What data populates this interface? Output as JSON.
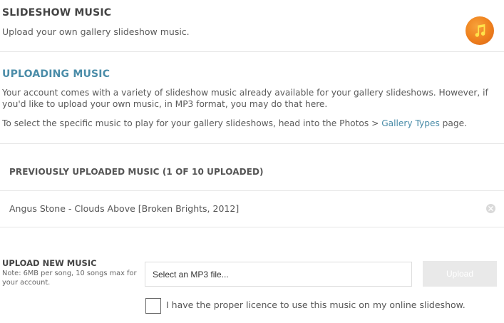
{
  "header": {
    "title": "SLIDESHOW MUSIC",
    "subtitle": "Upload your own gallery slideshow music.",
    "icon": "music-note-icon",
    "icon_color": "#ee7f1c"
  },
  "uploading": {
    "title": "UPLOADING MUSIC",
    "paragraph1": "Your account comes with a variety of slideshow music already available for your gallery slideshows. However, if you'd like to upload your own music, in MP3 format, you may do that here.",
    "paragraph2_prefix": "To select the specific music to play for your gallery slideshows, head into the Photos > ",
    "paragraph2_link": "Gallery Types",
    "paragraph2_suffix": " page.",
    "link_color": "#4a8ca8"
  },
  "uploaded": {
    "heading": "PREVIOUSLY UPLOADED MUSIC (1 OF 10 UPLOADED)",
    "tracks": [
      {
        "title": "Angus Stone - Clouds Above [Broken Brights, 2012]",
        "remove_icon": "remove-circle-icon"
      }
    ]
  },
  "upload_form": {
    "label": "UPLOAD NEW MUSIC",
    "note": "Note: 6MB per song, 10 songs max for your account.",
    "file_placeholder": "Select an MP3 file...",
    "upload_button": "Upload",
    "licence_checkbox_label": "I have the proper licence to use this music on my online slideshow.",
    "licence_checked": false
  }
}
